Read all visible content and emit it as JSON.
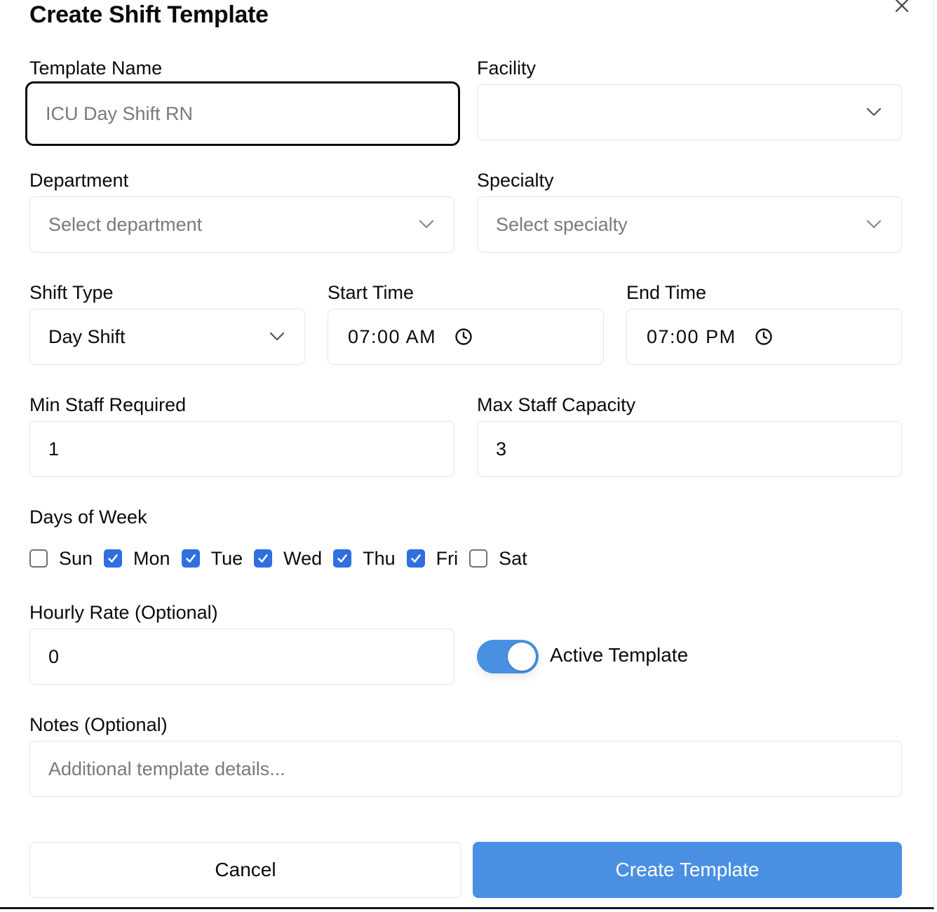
{
  "dialog": {
    "title": "Create Shift Template"
  },
  "form": {
    "template_name": {
      "label": "Template Name",
      "value": "",
      "placeholder": "ICU Day Shift RN"
    },
    "facility": {
      "label": "Facility",
      "value": ""
    },
    "department": {
      "label": "Department",
      "placeholder": "Select department"
    },
    "specialty": {
      "label": "Specialty",
      "placeholder": "Select specialty"
    },
    "shift_type": {
      "label": "Shift Type",
      "value": "Day Shift"
    },
    "start_time": {
      "label": "Start Time",
      "value": "07:00 AM"
    },
    "end_time": {
      "label": "End Time",
      "value": "07:00 PM"
    },
    "min_staff": {
      "label": "Min Staff Required",
      "value": "1"
    },
    "max_staff": {
      "label": "Max Staff Capacity",
      "value": "3"
    },
    "days_of_week": {
      "label": "Days of Week",
      "days": [
        {
          "label": "Sun",
          "checked": false
        },
        {
          "label": "Mon",
          "checked": true
        },
        {
          "label": "Tue",
          "checked": true
        },
        {
          "label": "Wed",
          "checked": true
        },
        {
          "label": "Thu",
          "checked": true
        },
        {
          "label": "Fri",
          "checked": true
        },
        {
          "label": "Sat",
          "checked": false
        }
      ]
    },
    "hourly_rate": {
      "label": "Hourly Rate (Optional)",
      "value": "0"
    },
    "active_template": {
      "label": "Active Template",
      "on": true
    },
    "notes": {
      "label": "Notes (Optional)",
      "placeholder": "Additional template details..."
    }
  },
  "actions": {
    "cancel_label": "Cancel",
    "submit_label": "Create Template"
  },
  "colors": {
    "primary": "#4a90e2",
    "checkbox_checked": "#2f6fe0",
    "border": "#e2e5ea",
    "placeholder": "#7a7a7a"
  },
  "icons": {
    "close": "close-icon",
    "chevron": "chevron-down-icon",
    "clock": "clock-icon",
    "check": "check-icon"
  }
}
